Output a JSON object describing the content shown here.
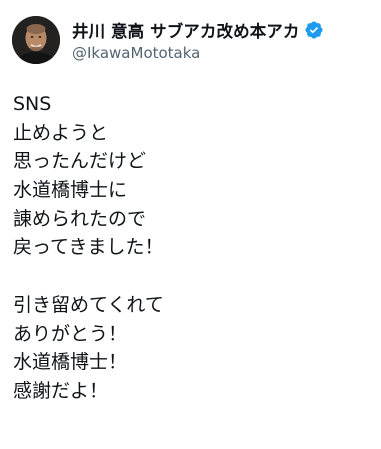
{
  "author": {
    "display_name": "井川 意高 サブアカ改め本アカ",
    "handle": "@IkawaMototaka",
    "verified": true,
    "verified_color": "#1d9bf0"
  },
  "tweet": {
    "lines": [
      "SNS",
      "止めようと",
      "思ったんだけど",
      "水道橋博士に",
      "諌められたので",
      "戻ってきました！",
      "",
      "引き留めてくれて",
      "ありがとう！",
      "水道橋博士！",
      "感謝だよ！"
    ]
  },
  "colors": {
    "text_primary": "#0f1419",
    "text_secondary": "#536471",
    "background": "#ffffff"
  }
}
